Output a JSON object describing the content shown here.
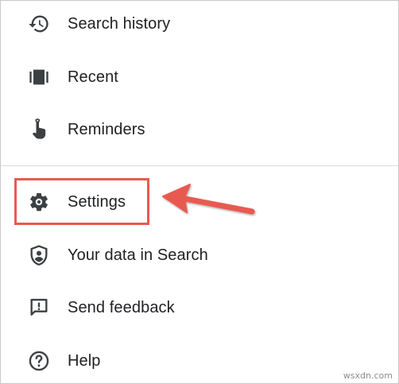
{
  "menu": {
    "items": [
      {
        "label": "Search history",
        "icon": "history-icon"
      },
      {
        "label": "Recent",
        "icon": "recent-icon"
      },
      {
        "label": "Reminders",
        "icon": "reminders-icon"
      },
      {
        "label": "Settings",
        "icon": "gear-icon"
      },
      {
        "label": "Your data in Search",
        "icon": "shield-account-icon"
      },
      {
        "label": "Send feedback",
        "icon": "feedback-icon"
      },
      {
        "label": "Help",
        "icon": "help-icon"
      }
    ],
    "highlighted_item": "Settings"
  },
  "annotation": {
    "highlight_color": "#e85a4f",
    "arrow_color": "#e85a4f"
  },
  "watermark": "wsxdn.com",
  "colors": {
    "text": "#202124",
    "icon": "#3c4043",
    "divider": "#dadce0"
  }
}
